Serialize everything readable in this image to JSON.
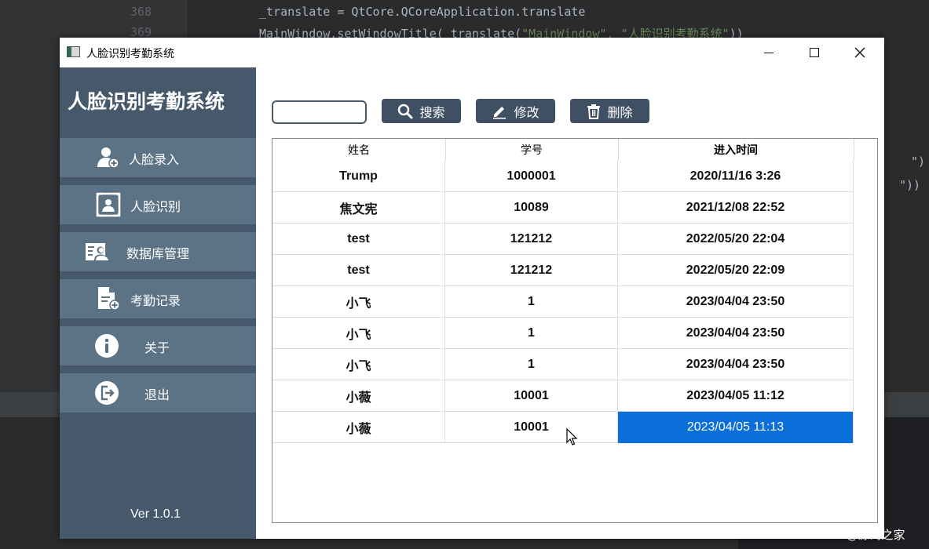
{
  "editor": {
    "line_numbers": [
      "368",
      "369"
    ],
    "code_line_1": "_translate = QtCore.QCoreApplication.translate",
    "code_line_2_a": "MainWindow.setWindowTitle(_translate(",
    "code_line_2_s": "\"MainWindow\", \"人脸识别考勤系统\"",
    "code_line_2_b": "))",
    "frag_1": "\")",
    "frag_2": "\"))"
  },
  "window": {
    "title": "人脸识别考勤系统",
    "controls": {
      "minimize": "minimize",
      "maximize": "maximize",
      "close": "close"
    }
  },
  "sidebar": {
    "app_title": "人脸识别考勤系统",
    "items": [
      {
        "label": "人脸录入",
        "icon": "add-user-icon"
      },
      {
        "label": "人脸识别",
        "icon": "face-scan-icon"
      },
      {
        "label": "数据库管理",
        "icon": "database-user-icon"
      },
      {
        "label": "考勤记录",
        "icon": "document-add-icon"
      },
      {
        "label": "关于",
        "icon": "info-icon"
      },
      {
        "label": "退出",
        "icon": "exit-icon"
      }
    ],
    "version": "Ver 1.0.1"
  },
  "toolbar": {
    "search_value": "",
    "search_label": "搜索",
    "edit_label": "修改",
    "delete_label": "删除"
  },
  "table": {
    "columns": [
      "姓名",
      "学号",
      "进入时间"
    ],
    "rows": [
      [
        "Trump",
        "1000001",
        "2020/11/16 3:26"
      ],
      [
        "焦文宪",
        "10089",
        "2021/12/08 22:52"
      ],
      [
        "test",
        "121212",
        "2022/05/20 22:04"
      ],
      [
        "test",
        "121212",
        "2022/05/20 22:09"
      ],
      [
        "小飞",
        "1",
        "2023/04/04 23:50"
      ],
      [
        "小飞",
        "1",
        "2023/04/04 23:50"
      ],
      [
        "小飞",
        "1",
        "2023/04/04 23:50"
      ],
      [
        "小薇",
        "10001",
        "2023/04/05 11:12"
      ],
      [
        "小薇",
        "10001",
        "2023/04/05 11:13"
      ]
    ],
    "selected_cell": {
      "row": 8,
      "col": 2
    }
  },
  "colors": {
    "sidebar_bg": "#46596b",
    "nav_button_bg": "#5c7386",
    "toolbar_button_bg": "#3f5062",
    "selection": "#0a6fd8"
  },
  "watermark": "CSDN @源码之家"
}
